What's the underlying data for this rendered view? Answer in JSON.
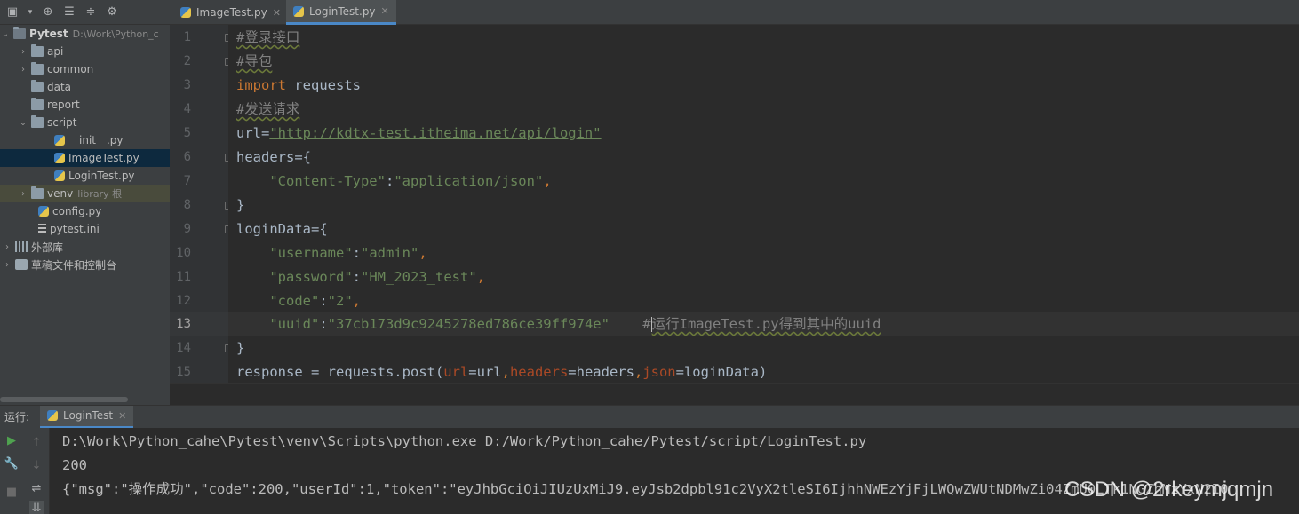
{
  "tabs": [
    {
      "label": "ImageTest.py",
      "active": false
    },
    {
      "label": "LoginTest.py",
      "active": true
    }
  ],
  "project": {
    "root_name": "Pytest",
    "root_path": "D:\\Work\\Python_c",
    "items": [
      {
        "label": "api"
      },
      {
        "label": "common"
      },
      {
        "label": "data"
      },
      {
        "label": "report"
      },
      {
        "label": "script"
      },
      {
        "label": "__init__.py"
      },
      {
        "label": "ImageTest.py"
      },
      {
        "label": "LoginTest.py"
      },
      {
        "label": "venv",
        "hint": "library 根"
      },
      {
        "label": "config.py"
      },
      {
        "label": "pytest.ini"
      },
      {
        "label": "外部库"
      },
      {
        "label": "草稿文件和控制台"
      }
    ]
  },
  "editor": {
    "current_line": 13,
    "line_numbers": [
      "1",
      "2",
      "3",
      "4",
      "5",
      "6",
      "7",
      "8",
      "9",
      "10",
      "11",
      "12",
      "13",
      "14",
      "15"
    ],
    "code": {
      "l1": "#登录接口",
      "l2": "#导包",
      "l3_kw": "import",
      "l3_rest": " requests",
      "l4": "#发送请求",
      "l5_var": "url=",
      "l5_str": "\"http://kdtx-test.itheima.net/api/login\"",
      "l6": "headers={",
      "l7_key": "\"Content-Type\"",
      "l7_colon": ":",
      "l7_val": "\"application/json\"",
      "l7_comma": ",",
      "l8": "}",
      "l9": "loginData={",
      "l10_key": "\"username\"",
      "l10_val": "\"admin\"",
      "l11_key": "\"password\"",
      "l11_val": "\"HM_2023_test\"",
      "l12_key": "\"code\"",
      "l12_val": "\"2\"",
      "l13_key": "\"uuid\"",
      "l13_val": "\"37cb173d9c9245278ed786ce39ff974e\"",
      "l13_comment_hash": "#",
      "l13_comment": "运行ImageTest.py得到其中的uuid",
      "l14": "}",
      "l15_a": "response = requests.post(",
      "l15_p1": "url",
      "l15_b": "=url",
      "l15_c": ",",
      "l15_p2": "headers",
      "l15_d": "=headers",
      "l15_e": ",",
      "l15_p3": "json",
      "l15_f": "=loginData)"
    }
  },
  "run": {
    "label": "运行:",
    "tab": "LoginTest",
    "lines": [
      "D:\\Work\\Python_cahe\\Pytest\\venv\\Scripts\\python.exe D:/Work/Python_cahe/Pytest/script/LoginTest.py",
      "200",
      "{\"msg\":\"操作成功\",\"code\":200,\"userId\":1,\"token\":\"eyJhbGciOiJIUzUxMiJ9.eyJsb2dpbl91c2VyX2tleSI6IjhhNWEzYjFjLWQwZWUtNDMwZi04ZmU0LTk1NGZhMzYxN2I0"
    ]
  },
  "watermark": "CSDN @2rkeymjqmjn",
  "colors": {
    "keyword": "#cc7832",
    "string": "#6a8759",
    "comment": "#808080",
    "param": "#aa4926",
    "accent": "#4a88c7"
  }
}
